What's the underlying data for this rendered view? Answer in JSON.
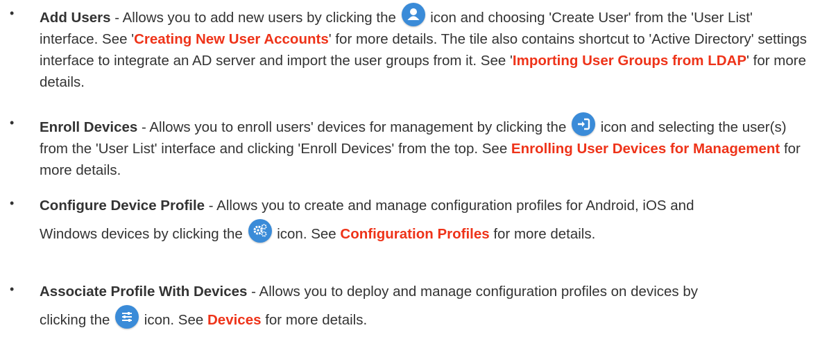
{
  "items": [
    {
      "title": "Add Users",
      "pre_icon": " - Allows you to add new users by clicking the ",
      "icon": "user-icon",
      "post_icon": " icon and choosing 'Create User' from the 'User List' interface. See '",
      "link1": "Creating New User Accounts",
      "mid1": "' for more details. The tile also contains shortcut to 'Active Directory' settings interface to integrate an AD server and import the user groups from it. See '",
      "link2": "Importing User Groups from LDAP",
      "end": "' for more details."
    },
    {
      "title": "Enroll Devices",
      "pre_icon": " - Allows you to enroll users' devices for management by clicking the ",
      "icon": "enroll-icon",
      "post_icon": " icon and selecting the user(s) from the 'User List' interface and clicking 'Enroll Devices' from the top. See ",
      "link1": "Enrolling User Devices for Management",
      "end": " for more details."
    },
    {
      "title": "Configure Device Profile",
      "line1": " - Allows you to create and manage configuration profiles for Android, iOS and",
      "pre_icon": "Windows devices by clicking the ",
      "icon": "gears-icon",
      "post_icon": " icon. See ",
      "link1": "Configuration Profiles",
      "end": " for more details."
    },
    {
      "title": "Associate Profile With Devices",
      "line1": " - Allows you to deploy and manage configuration profiles on devices by",
      "pre_icon": "clicking the ",
      "icon": "sliders-icon",
      "post_icon": " icon. See ",
      "link1": "Devices",
      "end": " for more details."
    }
  ],
  "colors": {
    "link": "#ee3319",
    "icon_bg": "#3a8bd8",
    "text": "#333333"
  }
}
